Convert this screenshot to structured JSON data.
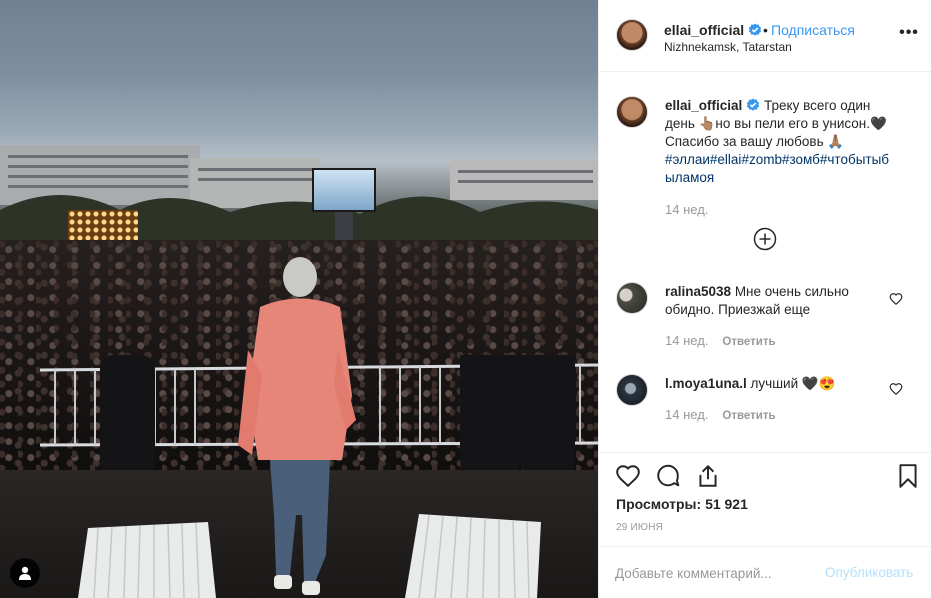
{
  "post": {
    "username": "ellai_official",
    "follow_label": "Подписаться",
    "separator": "•",
    "location": "Nizhnekamsk, Tatarstan",
    "more_label": "•••"
  },
  "caption": {
    "username": "ellai_official",
    "line1": " Треку всего один день 👆🏽но вы пели его в унисон.🖤",
    "line2": "Спасибо за вашу любовь 🙏🏽",
    "hashtags": [
      "#эллаи",
      "#ellai",
      "#zomb",
      "#зомб",
      "#чтобытыбыламоя"
    ],
    "time": "14 нед."
  },
  "comments": [
    {
      "username": "ralina5038",
      "text": " Мне очень сильно обидно. Приезжай еще",
      "time": "14 нед.",
      "reply_label": "Ответить"
    },
    {
      "username": "l.moya1una.l",
      "text": " лучший 🖤😍",
      "time": "14 нед.",
      "reply_label": "Ответить"
    }
  ],
  "icons": {
    "verified": "verified-badge-icon",
    "more": "more-options-icon",
    "load_more": "plus-circle-icon",
    "like": "heart-icon",
    "comment": "comment-icon",
    "share": "share-icon",
    "save": "bookmark-icon",
    "user_tag": "user-tag-icon"
  },
  "stats": {
    "views_label": "Просмотры:",
    "views_value": "51 921",
    "date": "29 ИЮНЯ"
  },
  "add_comment": {
    "placeholder": "Добавьте комментарий...",
    "publish_label": "Опубликовать"
  },
  "colors": {
    "link": "#3897f0",
    "hashtag": "#003569",
    "muted": "#999999",
    "publish_disabled": "#b2dffc",
    "verified": "#3897f0"
  }
}
